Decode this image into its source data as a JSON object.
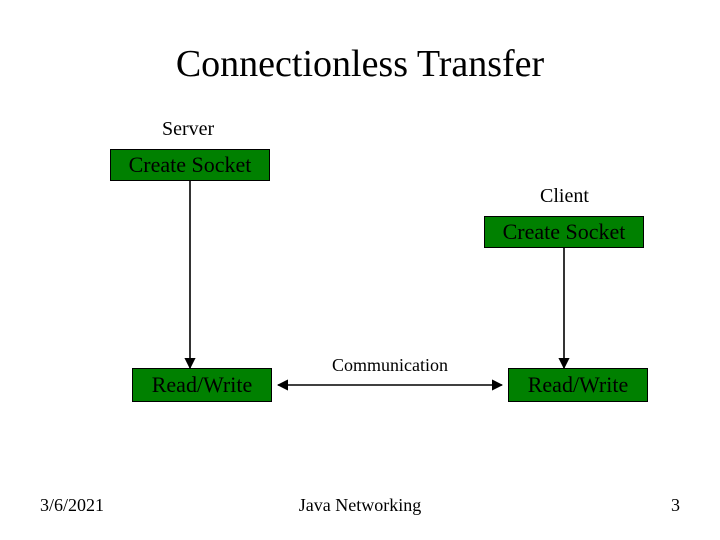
{
  "title": "Connectionless Transfer",
  "server_label": "Server",
  "client_label": "Client",
  "boxes": {
    "server_create": "Create Socket",
    "client_create": "Create Socket",
    "server_rw": "Read/Write",
    "client_rw": "Read/Write"
  },
  "comm_label": "Communication",
  "footer": {
    "date": "3/6/2021",
    "title": "Java Networking",
    "page": "3"
  },
  "chart_data": {
    "type": "diagram",
    "title": "Connectionless Transfer",
    "nodes": [
      {
        "id": "server_create",
        "label": "Create Socket",
        "group": "Server"
      },
      {
        "id": "server_rw",
        "label": "Read/Write",
        "group": "Server"
      },
      {
        "id": "client_create",
        "label": "Create Socket",
        "group": "Client"
      },
      {
        "id": "client_rw",
        "label": "Read/Write",
        "group": "Client"
      }
    ],
    "edges": [
      {
        "from": "server_create",
        "to": "server_rw",
        "directed": true
      },
      {
        "from": "client_create",
        "to": "client_rw",
        "directed": true
      },
      {
        "from": "server_rw",
        "to": "client_rw",
        "directed": true,
        "label": "Communication",
        "bidirectional": true
      }
    ]
  }
}
